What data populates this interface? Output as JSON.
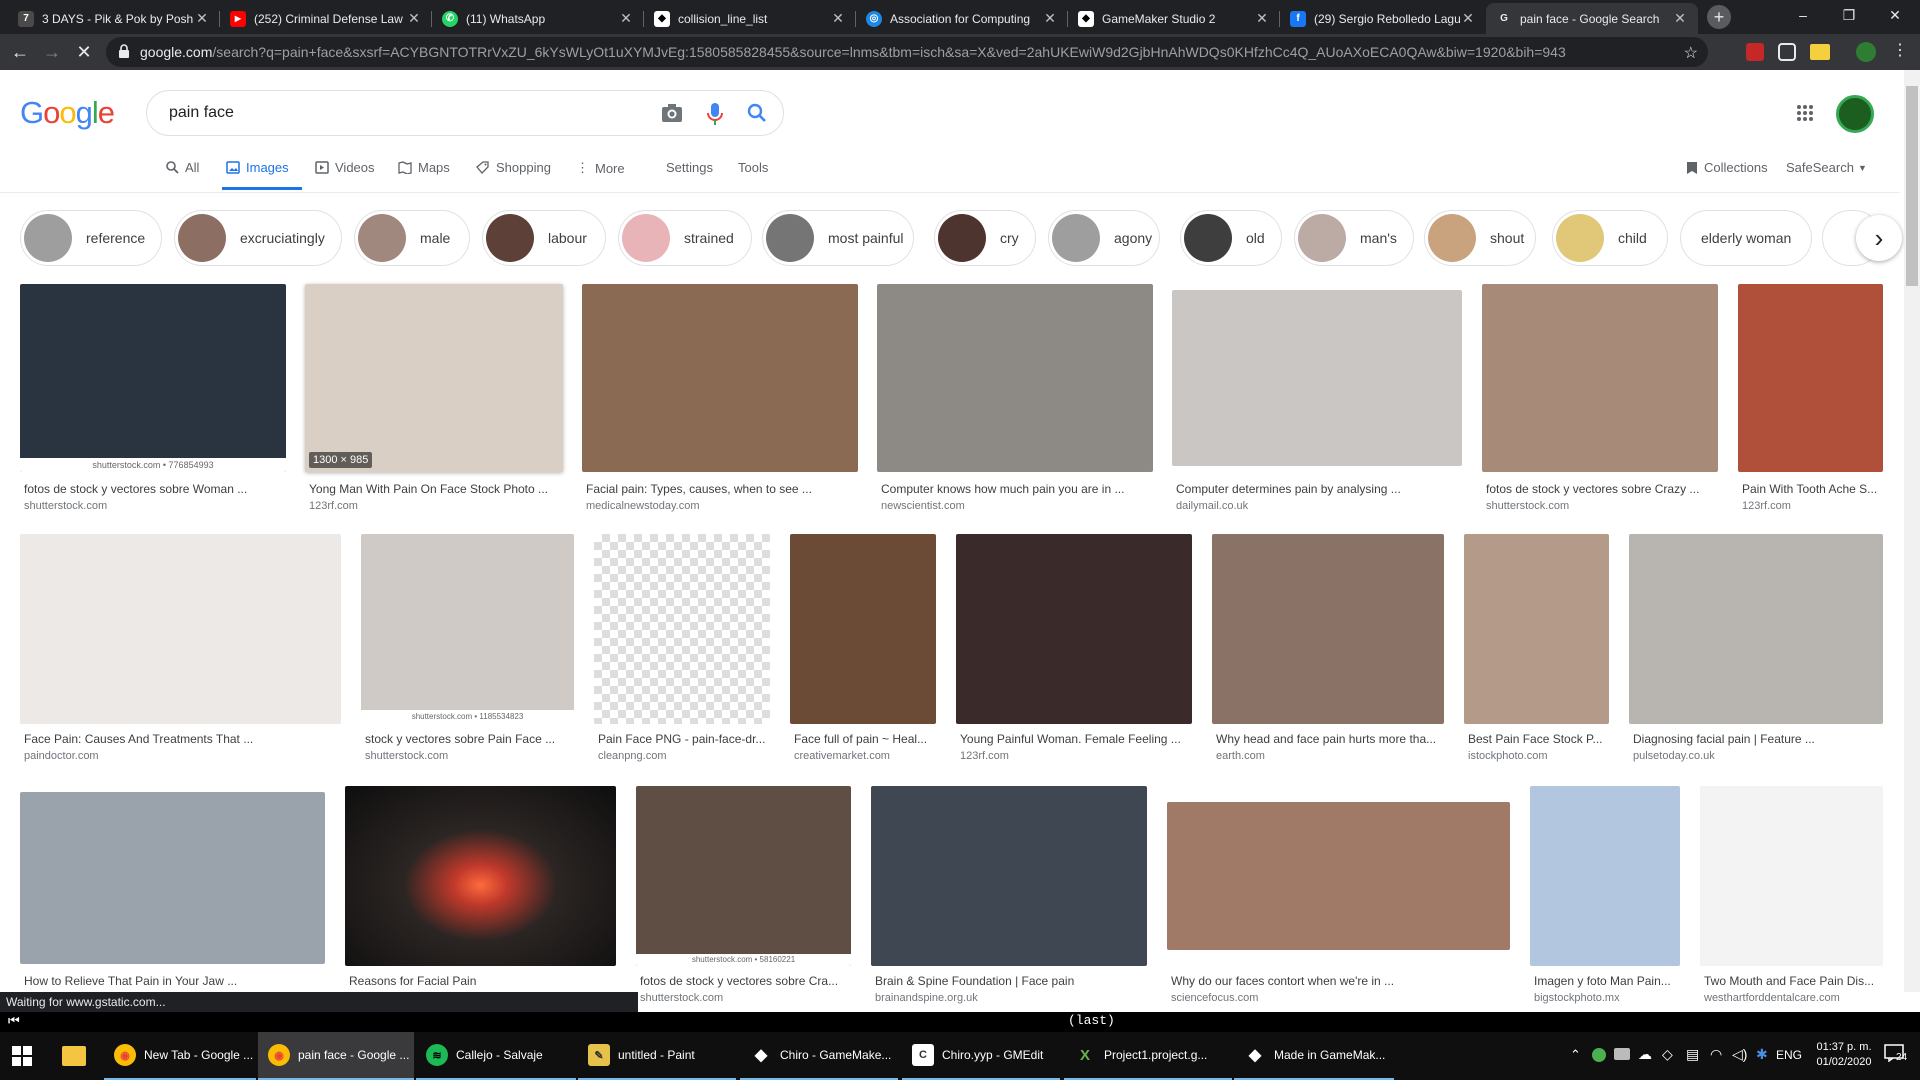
{
  "browser": {
    "tabs": [
      {
        "title": "3 DAYS - Pik & Pok by Posh",
        "favicon_color": "#4a4a4a",
        "favicon_glyph": "7"
      },
      {
        "title": "(252) Criminal Defense Law",
        "favicon_color": "#ff0000",
        "favicon_glyph": "▶"
      },
      {
        "title": "(11) WhatsApp",
        "favicon_color": "#25d366",
        "favicon_glyph": "✆"
      },
      {
        "title": "collision_line_list",
        "favicon_color": "#ffffff",
        "favicon_glyph": "◆"
      },
      {
        "title": "Association for Computing",
        "favicon_color": "#1e88e5",
        "favicon_glyph": "◎"
      },
      {
        "title": "GameMaker Studio 2",
        "favicon_color": "#ffffff",
        "favicon_glyph": "◆"
      },
      {
        "title": "(29) Sergio Rebolledo Lagu",
        "favicon_color": "#1877f2",
        "favicon_glyph": "f"
      },
      {
        "title": "pain face - Google Search",
        "favicon_color": "#35363a",
        "favicon_glyph": "G"
      }
    ],
    "url_host": "google.com",
    "url_rest": "/search?q=pain+face&sxsrf=ACYBGNTOTRrVxZU_6kYsWLyOt1uXYMJvEg:1580585828455&source=lnms&tbm=isch&sa=X&ved=2ahUKEwiW9d2GjbHnAhWDQs0KHfzhCc4Q_AUoAXoECA0QAw&biw=1920&bih=943"
  },
  "google": {
    "logo": "Google",
    "query": "pain face",
    "nav": [
      {
        "label": "All",
        "icon": "search-icon"
      },
      {
        "label": "Images",
        "icon": "image-icon"
      },
      {
        "label": "Videos",
        "icon": "video-icon"
      },
      {
        "label": "Maps",
        "icon": "map-icon"
      },
      {
        "label": "Shopping",
        "icon": "tag-icon"
      },
      {
        "label": "More",
        "icon": "more-dots-icon"
      },
      {
        "label": "Settings"
      },
      {
        "label": "Tools"
      }
    ],
    "collections": "Collections",
    "safesearch": "SafeSearch"
  },
  "chips": [
    {
      "label": "reference",
      "color": "#9e9e9e"
    },
    {
      "label": "excruciatingly",
      "color": "#8d6e63"
    },
    {
      "label": "male",
      "color": "#a1887f"
    },
    {
      "label": "labour",
      "color": "#5d4037"
    },
    {
      "label": "strained",
      "color": "#e8b4b8"
    },
    {
      "label": "most painful",
      "color": "#757575"
    },
    {
      "label": "cry",
      "color": "#4e342e"
    },
    {
      "label": "agony",
      "color": "#9e9e9e"
    },
    {
      "label": "old",
      "color": "#3e3e3e"
    },
    {
      "label": "man's",
      "color": "#bcaaa4"
    },
    {
      "label": "shout",
      "color": "#c9a27e"
    },
    {
      "label": "child",
      "color": "#e0c878"
    },
    {
      "label": "elderly woman",
      "color": ""
    }
  ],
  "results": [
    {
      "title": "fotos de stock y vectores sobre Woman ...",
      "source": "shutterstock.com",
      "color": "#2a3340",
      "overlay": "shutterstock.com • 776854993"
    },
    {
      "title": "Yong Man With Pain On Face Stock Photo ...",
      "source": "123rf.com",
      "color": "#d9cfc4",
      "dims": "1300 × 985"
    },
    {
      "title": "Facial pain: Types, causes, when to see ...",
      "source": "medicalnewstoday.com",
      "color": "#8a6a52"
    },
    {
      "title": "Computer knows how much pain you are in ...",
      "source": "newscientist.com",
      "color": "#8d8a86"
    },
    {
      "title": "Computer determines pain by analysing ...",
      "source": "dailymail.co.uk",
      "color": "#c9c6c3"
    },
    {
      "title": "fotos de stock y vectores sobre Crazy ...",
      "source": "shutterstock.com",
      "color": "#a78a78"
    },
    {
      "title": "Pain With Tooth Ache S...",
      "source": "123rf.com",
      "color": "#b0503a"
    },
    {
      "title": "Face Pain: Causes And Treatments That ...",
      "source": "paindoctor.com",
      "color": "#ece9e6"
    },
    {
      "title": "stock y vectores sobre Pain Face ...",
      "source": "shutterstock.com",
      "color": "#cfcac6",
      "overlay": "shutterstock.com • 1185534823"
    },
    {
      "title": "Pain Face PNG - pain-face-dr...",
      "source": "cleanpng.com",
      "color": "#e6e6e6"
    },
    {
      "title": "Face full of pain ~ Heal...",
      "source": "creativemarket.com",
      "color": "#6b4a36"
    },
    {
      "title": "Young Painful Woman. Female Feeling ...",
      "source": "123rf.com",
      "color": "#3a2a2a"
    },
    {
      "title": "Why head and face pain hurts more tha...",
      "source": "earth.com",
      "color": "#8a7266"
    },
    {
      "title": "Best Pain Face Stock P...",
      "source": "istockphoto.com",
      "color": "#b49a88"
    },
    {
      "title": "Diagnosing facial pain | Feature ...",
      "source": "pulsetoday.co.uk",
      "color": "#b8b4b0"
    },
    {
      "title": "How to Relieve That Pain in Your Jaw ...",
      "source": "",
      "color": "#9aa3ab"
    },
    {
      "title": "Reasons for Facial Pain",
      "source": "",
      "color": "#3b2f2c"
    },
    {
      "title": "fotos de stock y vectores sobre Cra...",
      "source": "shutterstock.com",
      "color": "#5e4e44",
      "overlay": "shutterstock.com • 58160221"
    },
    {
      "title": "Brain & Spine Foundation | Face pain",
      "source": "brainandspine.org.uk",
      "color": "#3f4752"
    },
    {
      "title": "Why do our faces contort when we're in ...",
      "source": "sciencefocus.com",
      "color": "#a07a66"
    },
    {
      "title": "Imagen y foto Man Pain...",
      "source": "bigstockphoto.mx",
      "color": "#b3c6e0"
    },
    {
      "title": "Two Mouth and Face Pain Dis...",
      "source": "westhartforddentalcare.com",
      "color": "#f3f3f3"
    }
  ],
  "status": {
    "loading": "Waiting for www.gstatic.com...",
    "last": "(last)"
  },
  "taskbar": {
    "apps": [
      {
        "label": "New Tab - Google ...",
        "color": "#fbbc05",
        "glyph": "◉"
      },
      {
        "label": "pain face - Google ...",
        "color": "#fbbc05",
        "glyph": "◉"
      },
      {
        "label": "Callejo - Salvaje",
        "color": "#1db954",
        "glyph": "≋"
      },
      {
        "label": "untitled - Paint",
        "color": "#e6c24a",
        "glyph": "✎"
      },
      {
        "label": "Chiro - GameMake...",
        "color": "#ffffff",
        "glyph": "◆"
      },
      {
        "label": "Chiro.yyp - GMEdit",
        "color": "#ffffff",
        "glyph": "C"
      },
      {
        "label": "Project1.project.g...",
        "color": "#6ab04c",
        "glyph": "X"
      },
      {
        "label": "Made in GameMak...",
        "color": "#ffffff",
        "glyph": "◆"
      }
    ],
    "lang": "ENG",
    "time": "01:37 p. m.",
    "date": "01/02/2020",
    "notifications": "24"
  }
}
